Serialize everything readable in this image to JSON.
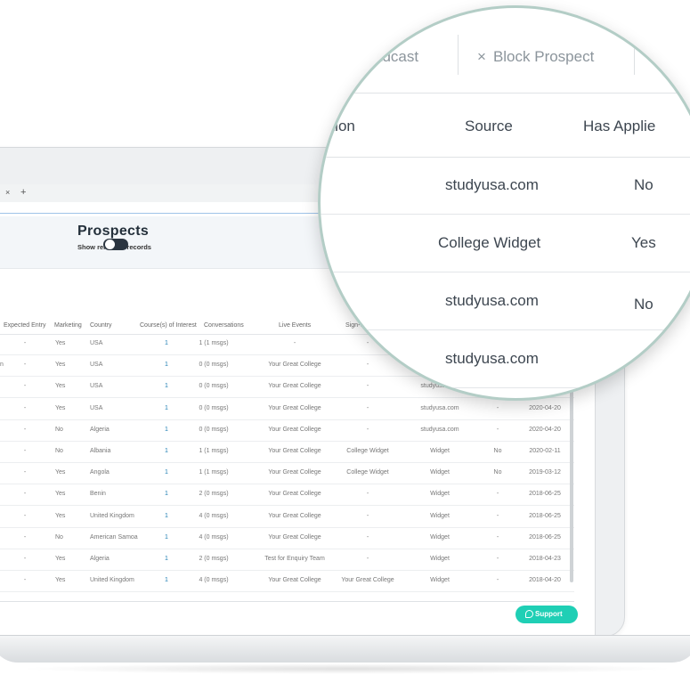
{
  "browser": {
    "tab_close": "×",
    "new_tab": "+"
  },
  "page": {
    "title": "Prospects",
    "show_removed_label": "Show removed records",
    "show_removed_on": true
  },
  "table": {
    "columns": [
      "Expected Entry",
      "Marketing",
      "Country",
      "Course(s) of Interest",
      "Conversations",
      "Live Events",
      "Sign-Up"
    ],
    "rows": [
      {
        "lead": "",
        "entry": "-",
        "marketing": "Yes",
        "country": "USA",
        "courses": "1",
        "conversations": "1 (1 msgs)",
        "live_events": "-",
        "signup": "-",
        "source": "",
        "applied": "",
        "date": ""
      },
      {
        "lead": "n",
        "entry": "-",
        "marketing": "Yes",
        "country": "USA",
        "courses": "1",
        "conversations": "0 (0 msgs)",
        "live_events": "Your Great College",
        "signup": "-",
        "source": "College",
        "applied": "",
        "date": ""
      },
      {
        "lead": "",
        "entry": "-",
        "marketing": "Yes",
        "country": "USA",
        "courses": "1",
        "conversations": "0 (0 msgs)",
        "live_events": "Your Great College",
        "signup": "-",
        "source": "studyusa.com",
        "applied": "No",
        "date": "2020-04-21"
      },
      {
        "lead": "",
        "entry": "-",
        "marketing": "Yes",
        "country": "USA",
        "courses": "1",
        "conversations": "0 (0 msgs)",
        "live_events": "Your Great College",
        "signup": "-",
        "source": "studyusa.com",
        "applied": "-",
        "date": "2020-04-20"
      },
      {
        "lead": "",
        "entry": "-",
        "marketing": "No",
        "country": "Algeria",
        "courses": "1",
        "conversations": "0 (0 msgs)",
        "live_events": "Your Great College",
        "signup": "-",
        "source": "studyusa.com",
        "applied": "-",
        "date": "2020-04-20"
      },
      {
        "lead": "",
        "entry": "-",
        "marketing": "No",
        "country": "Albania",
        "courses": "1",
        "conversations": "1 (1 msgs)",
        "live_events": "Your Great College",
        "signup": "College Widget",
        "source": "Widget",
        "applied": "No",
        "date": "2020-02-11"
      },
      {
        "lead": "",
        "entry": "-",
        "marketing": "Yes",
        "country": "Angola",
        "courses": "1",
        "conversations": "1 (1 msgs)",
        "live_events": "Your Great College",
        "signup": "College Widget",
        "source": "Widget",
        "applied": "No",
        "date": "2019-03-12"
      },
      {
        "lead": "",
        "entry": "-",
        "marketing": "Yes",
        "country": "Benin",
        "courses": "1",
        "conversations": "2 (0 msgs)",
        "live_events": "Your Great College",
        "signup": "-",
        "source": "Widget",
        "applied": "-",
        "date": "2018-06-25"
      },
      {
        "lead": "",
        "entry": "-",
        "marketing": "Yes",
        "country": "United Kingdom",
        "courses": "1",
        "conversations": "4 (0 msgs)",
        "live_events": "Your Great College",
        "signup": "-",
        "source": "Widget",
        "applied": "-",
        "date": "2018-06-25"
      },
      {
        "lead": "",
        "entry": "-",
        "marketing": "No",
        "country": "American Samoa",
        "courses": "1",
        "conversations": "4 (0 msgs)",
        "live_events": "Your Great College",
        "signup": "-",
        "source": "Widget",
        "applied": "-",
        "date": "2018-06-25"
      },
      {
        "lead": "",
        "entry": "-",
        "marketing": "Yes",
        "country": "Algeria",
        "courses": "1",
        "conversations": "2 (0 msgs)",
        "live_events": "Test for Enquiry Team",
        "signup": "-",
        "source": "Widget",
        "applied": "-",
        "date": "2018-04-23"
      },
      {
        "lead": "",
        "entry": "-",
        "marketing": "Yes",
        "country": "United Kingdom",
        "courses": "1",
        "conversations": "4 (0 msgs)",
        "live_events": "Your Great College",
        "signup": "Your Great College",
        "source": "Widget",
        "applied": "-",
        "date": "2018-04-20"
      }
    ]
  },
  "support": {
    "label": "Support"
  },
  "magnifier": {
    "toolbar": {
      "broadcast": "adcast",
      "block_icon": "×",
      "block": "Block Prospect"
    },
    "headers": {
      "partial": "ation",
      "source": "Source",
      "applied": "Has Applie"
    },
    "rows": [
      {
        "source": "studyusa.com",
        "applied": "No"
      },
      {
        "source": "College Widget",
        "applied": "Yes"
      },
      {
        "source": "studyusa.com",
        "applied": "No"
      },
      {
        "source": "studyusa.com",
        "applied": ""
      }
    ]
  },
  "colors": {
    "accent": "#1f7fb3",
    "support": "#1fcfb5",
    "magnifier_ring": "#b3cdc6"
  }
}
